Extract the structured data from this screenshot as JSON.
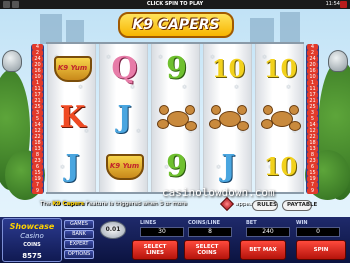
{
  "top_bar": {
    "hint": "CLICK SPIN TO PLAY",
    "time": "11:54"
  },
  "logo": {
    "text": "K9 CAPERS"
  },
  "paylines_left": [
    "4",
    "2",
    "24",
    "20",
    "16",
    "10",
    "1",
    "11",
    "17",
    "21",
    "25",
    "3",
    "5",
    "14",
    "12",
    "22",
    "18",
    "13",
    "8",
    "23",
    "6",
    "15",
    "19",
    "7",
    "9"
  ],
  "paylines_right": [
    "4",
    "2",
    "24",
    "20",
    "16",
    "10",
    "1",
    "11",
    "17",
    "21",
    "25",
    "3",
    "5",
    "14",
    "12",
    "22",
    "18",
    "13",
    "8",
    "23",
    "6",
    "15",
    "19",
    "7",
    "9"
  ],
  "reels": [
    [
      "dog-bowl",
      "K",
      "J"
    ],
    [
      "Q",
      "J",
      "dog-bowl"
    ],
    [
      "9",
      "teddy-bear",
      "9"
    ],
    [
      "10",
      "teddy-bear",
      "J"
    ],
    [
      "10",
      "teddy-bear",
      "10"
    ]
  ],
  "bowl_label": "K9 Yum",
  "message": {
    "prefix": "The ",
    "highlight": "K9 Capers",
    "suffix": " Feature is triggered when 3 or more",
    "tail": "appear"
  },
  "buttons_top": {
    "rules": "RULES",
    "paytable": "PAYTABLE"
  },
  "watermark": "casinolowdown.com",
  "panel": {
    "brand_line1": "Showcase",
    "brand_line2": "Casino",
    "coins_label": "COINS",
    "coins_value": "8575",
    "menu": [
      "GAMES",
      "BANK",
      "EXPERT",
      "OPTIONS"
    ],
    "coin_size": "0.01",
    "lines_label": "LINES",
    "lines_value": "30",
    "coins_per_line_label": "COINS/LINE",
    "coins_per_line_value": "8",
    "bet_label": "BET",
    "bet_value": "240",
    "win_label": "WIN",
    "win_value": "0",
    "select_lines": "SELECT LINES",
    "select_coins": "SELECT COINS",
    "bet_max": "BET MAX",
    "spin": "SPIN"
  },
  "colors": {
    "accent_red": "#e23a2b",
    "panel_blue": "#1f2a6b",
    "logo_yellow": "#ffe35b"
  }
}
